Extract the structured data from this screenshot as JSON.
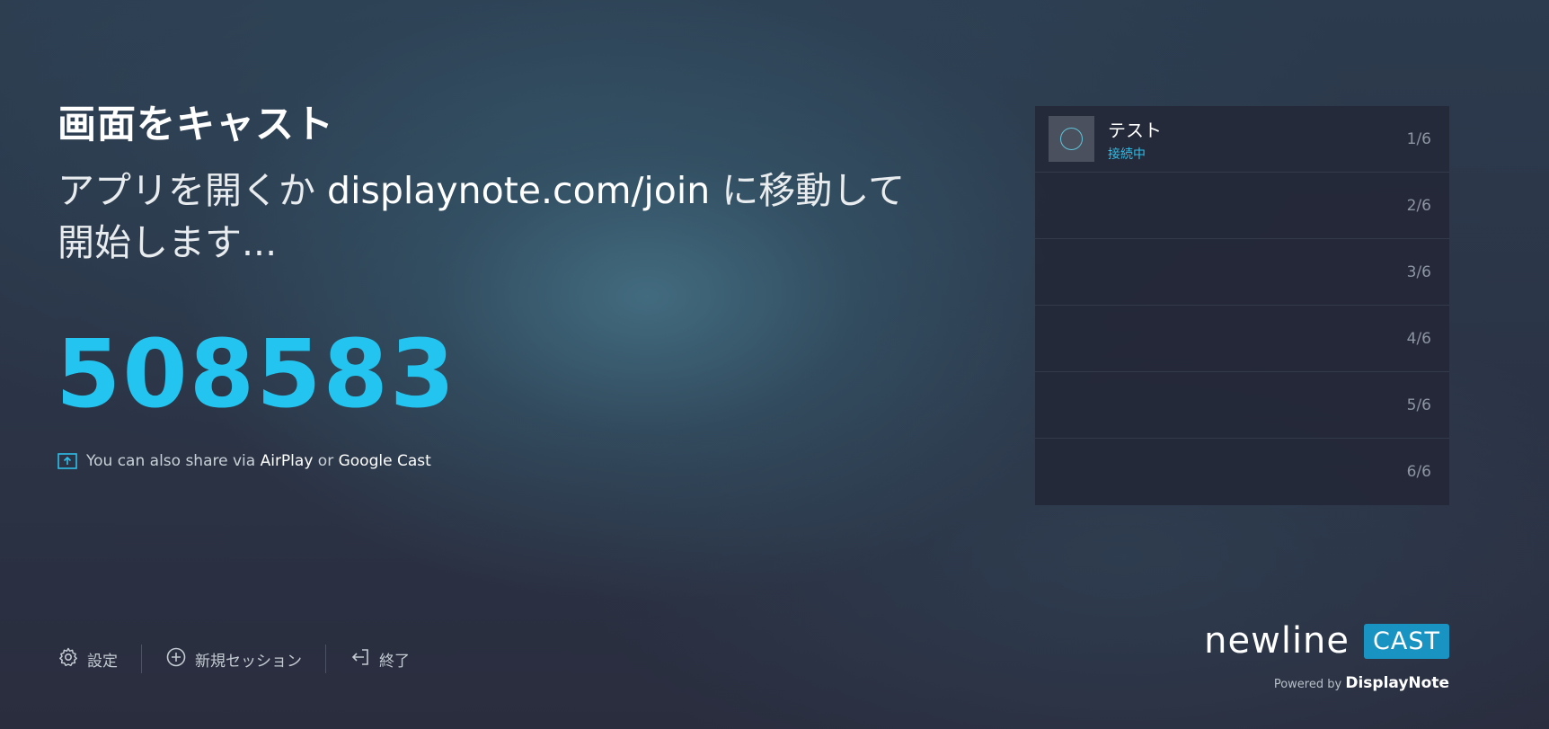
{
  "main": {
    "title": "画面をキャスト",
    "instruction_prefix": "アプリを開くか ",
    "instruction_url": "displaynote.com/join",
    "instruction_suffix": " に移動して開始します...",
    "code": "508583",
    "share_prefix": "You can also share via ",
    "share_airplay": "AirPlay",
    "share_or": " or ",
    "share_googlecast": "Google Cast"
  },
  "sessions": {
    "slots": [
      {
        "index": "1/6",
        "name": "テスト",
        "status": "接続中"
      },
      {
        "index": "2/6"
      },
      {
        "index": "3/6"
      },
      {
        "index": "4/6"
      },
      {
        "index": "5/6"
      },
      {
        "index": "6/6"
      }
    ]
  },
  "footer": {
    "settings_label": "設定",
    "new_session_label": "新規セッション",
    "exit_label": "終了"
  },
  "brand": {
    "name": "newline",
    "badge": "CAST",
    "powered_by": "Powered by",
    "vendor": "DisplayNote"
  },
  "colors": {
    "accent": "#23c5f0",
    "badge": "#1993c2"
  },
  "icons": {
    "share": "upload-screen-icon",
    "settings": "gear-icon",
    "new_session": "plus-circle-icon",
    "exit": "exit-icon"
  }
}
